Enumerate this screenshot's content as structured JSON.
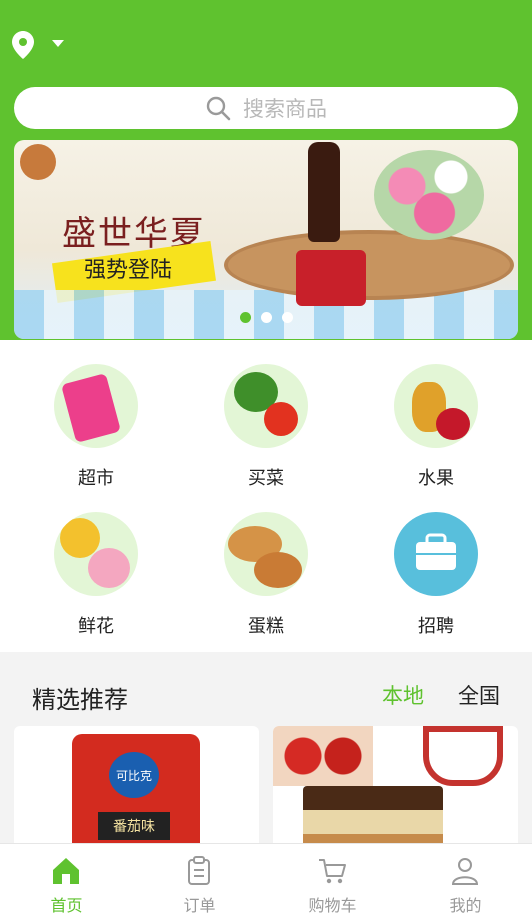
{
  "colors": {
    "accent": "#5fc22f",
    "text": "#222222",
    "muted": "#999999"
  },
  "header": {
    "location_icon": "location-pin-icon",
    "dropdown_icon": "caret-down-icon"
  },
  "search": {
    "placeholder": "搜索商品",
    "icon": "search-icon"
  },
  "banner": {
    "title": "盛世华夏",
    "subtitle": "强势登陆",
    "pagination": {
      "count": 3,
      "active_index": 0
    }
  },
  "categories": [
    {
      "label": "超市",
      "icon": "rice-bag-icon"
    },
    {
      "label": "买菜",
      "icon": "vegetables-icon"
    },
    {
      "label": "水果",
      "icon": "fruits-icon"
    },
    {
      "label": "鲜花",
      "icon": "flowers-icon"
    },
    {
      "label": "蛋糕",
      "icon": "bread-icon"
    },
    {
      "label": "招聘",
      "icon": "briefcase-icon"
    }
  ],
  "recommend": {
    "title": "精选推荐",
    "tabs": [
      {
        "label": "本地",
        "active": true
      },
      {
        "label": "全国",
        "active": false
      }
    ],
    "products": [
      {
        "image": "chips-bag",
        "brand": "可比克",
        "flavor": "番茄味"
      },
      {
        "image": "cake-and-coffee"
      }
    ]
  },
  "bottom_nav": [
    {
      "label": "首页",
      "icon": "home-icon",
      "active": true
    },
    {
      "label": "订单",
      "icon": "order-icon",
      "active": false
    },
    {
      "label": "购物车",
      "icon": "cart-icon",
      "active": false
    },
    {
      "label": "我的",
      "icon": "user-icon",
      "active": false
    }
  ]
}
